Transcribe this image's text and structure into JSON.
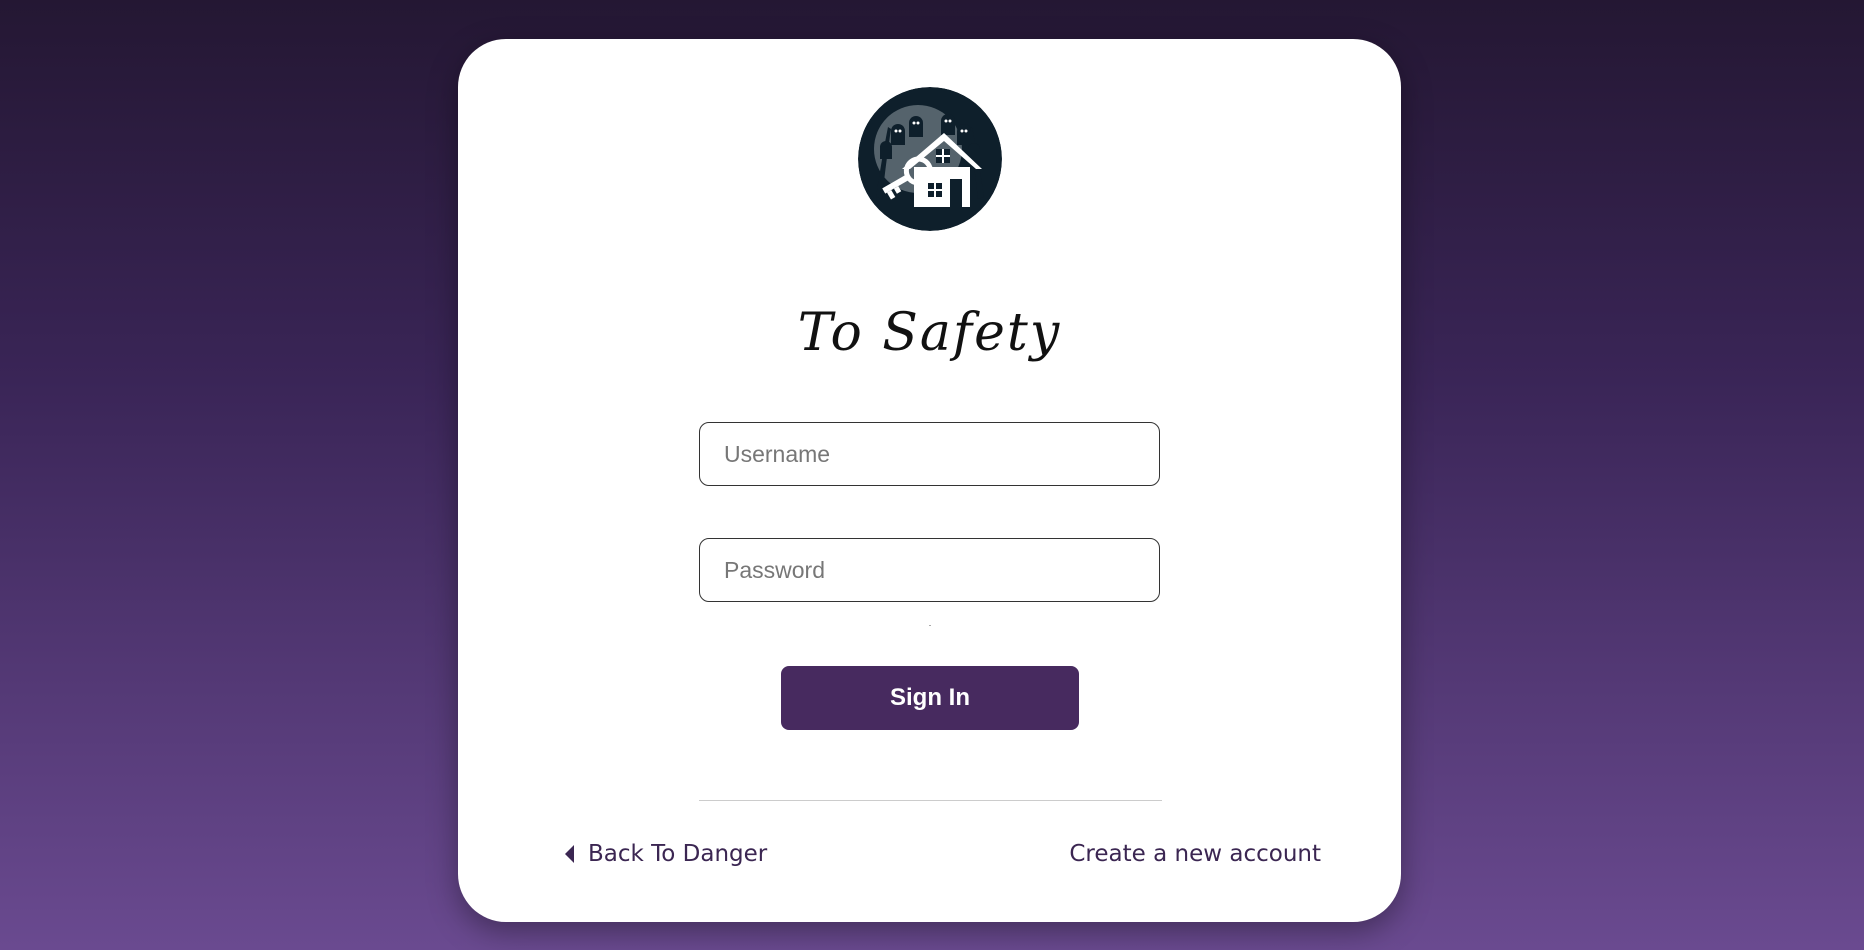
{
  "brand": {
    "title": "To Safety",
    "logo_icon": "haunted-house-key-icon"
  },
  "form": {
    "username_placeholder": "Username",
    "username_value": "",
    "password_placeholder": "Password",
    "password_value": "",
    "submit_label": "Sign In"
  },
  "footer": {
    "back_label": "Back To Danger",
    "back_icon": "caret-left-icon",
    "create_label": "Create a new account"
  },
  "colors": {
    "accent": "#472a5f",
    "link": "#3b2652",
    "bg_top": "#241733",
    "bg_bottom": "#6a4a90",
    "logo_bg": "#0e1f2b"
  }
}
